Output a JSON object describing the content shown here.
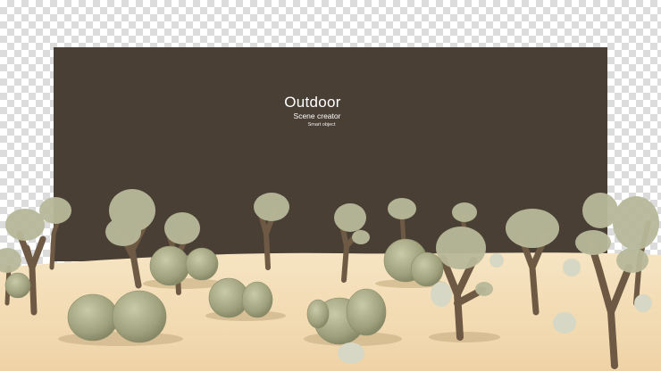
{
  "banner": {
    "title": "Outdoor",
    "subtitle": "Scene creator",
    "caption": "Smart object"
  },
  "colors": {
    "panel": "#4a3f35",
    "sand": "#f2dcb4",
    "cactus": "#a9ab8a",
    "trunk": "#6e5a44"
  },
  "scene": {
    "elements": [
      "cholla-cactus",
      "barrel-cactus",
      "desert-sand",
      "transparency-checkerboard"
    ]
  }
}
